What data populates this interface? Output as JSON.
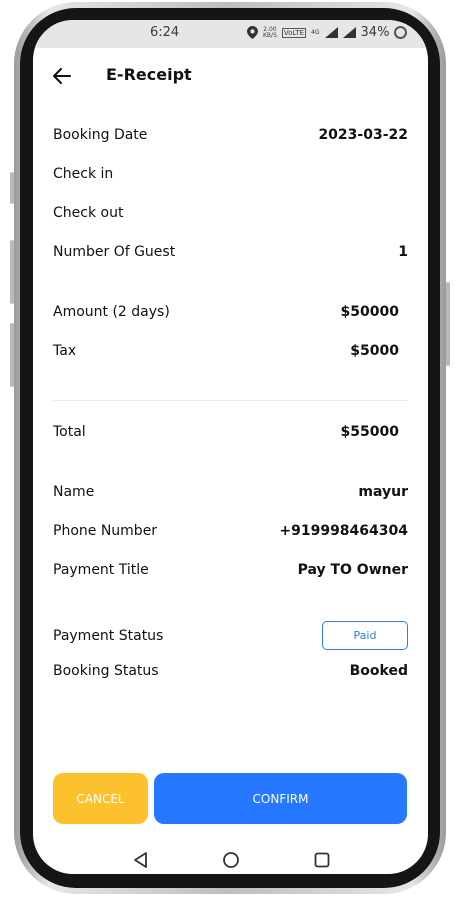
{
  "status_bar": {
    "time": "6:24",
    "net_speed": "2.00",
    "net_unit": "KB/S",
    "network_badge": "VoLTE",
    "signal_label": "4G",
    "battery": "34%"
  },
  "header": {
    "title": "E-Receipt",
    "back_icon": "arrow-left-icon"
  },
  "booking": {
    "date_label": "Booking Date",
    "date_value": "2023-03-22",
    "checkin_label": "Check in",
    "checkin_value": "",
    "checkout_label": "Check out",
    "checkout_value": "",
    "guests_label": "Number Of Guest",
    "guests_value": "1"
  },
  "amounts": {
    "amount_label": "Amount (2 days)",
    "amount_value": "$50000",
    "tax_label": "Tax",
    "tax_value": "$5000",
    "total_label": "Total",
    "total_value": "$55000"
  },
  "customer": {
    "name_label": "Name",
    "name_value": "mayur",
    "phone_label": "Phone Number",
    "phone_value": "+919998464304",
    "payment_title_label": "Payment Title",
    "payment_title_value": "Pay TO Owner"
  },
  "status": {
    "payment_label": "Payment Status",
    "payment_value": "Paid",
    "booking_label": "Booking Status",
    "booking_value": "Booked"
  },
  "actions": {
    "cancel_label": "CANCEL",
    "confirm_label": "CONFIRM"
  },
  "colors": {
    "cancel": "#fec12e",
    "confirm": "#2578ff",
    "paid_border": "#2f7fd6"
  },
  "nav": {
    "icons": [
      "back-triangle-icon",
      "home-circle-icon",
      "recents-square-icon"
    ]
  }
}
